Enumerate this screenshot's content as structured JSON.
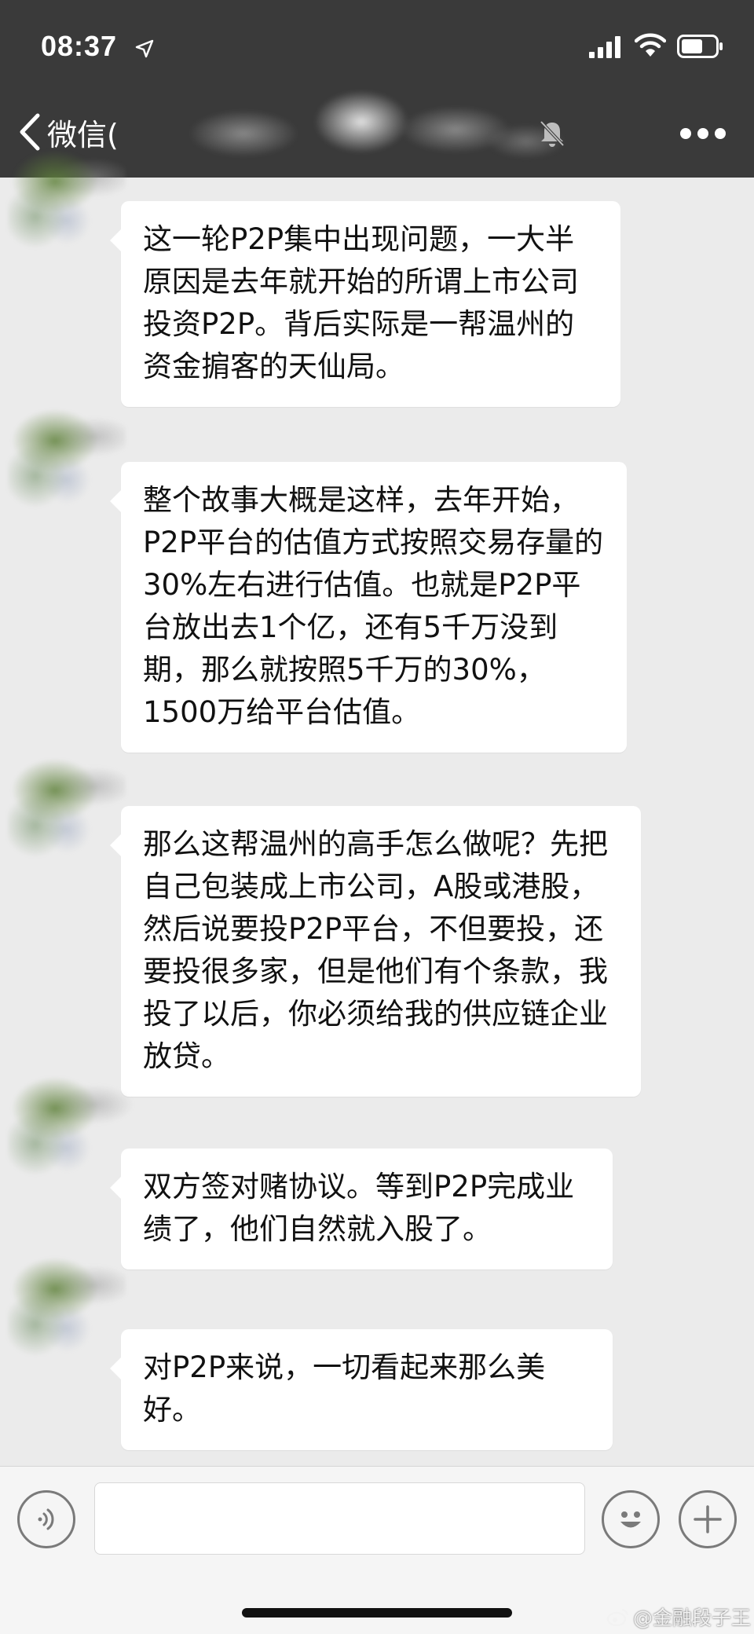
{
  "status_bar": {
    "time": "08:37"
  },
  "nav": {
    "back_label": "微信(",
    "chat_title": ""
  },
  "messages": [
    {
      "text": "这一轮P2P集中出现问题，一大半原因是去年就开始的所谓上市公司投资P2P。背后实际是一帮温州的资金掮客的天仙局。"
    },
    {
      "text": "整个故事大概是这样，去年开始，P2P平台的估值方式按照交易存量的30%左右进行估值。也就是P2P平台放出去1个亿，还有5千万没到期，那么就按照5千万的30%，1500万给平台估值。"
    },
    {
      "text": "那么这帮温州的高手怎么做呢？先把自己包装成上市公司，A股或港股，然后说要投P2P平台，不但要投，还要投很多家，但是他们有个条款，我投了以后，你必须给我的供应链企业放贷。"
    },
    {
      "text": "双方签对赌协议。等到P2P完成业绩了，他们自然就入股了。"
    },
    {
      "text": "对P2P来说，一切看起来那么美好。"
    }
  ],
  "watermark": {
    "text": "@金融段子王"
  },
  "icons": {
    "location": "location-arrow-icon",
    "signal": "cellular-signal-icon",
    "wifi": "wifi-icon",
    "battery": "battery-icon",
    "back": "chevron-left-icon",
    "mute": "mute-bell-icon",
    "more": "more-dots-icon",
    "voice": "voice-icon",
    "emoji": "emoji-icon",
    "plus": "plus-icon"
  },
  "colors": {
    "topbar_bg": "#3a3a3a",
    "chat_bg": "#ebebeb",
    "bubble_bg": "#ffffff"
  }
}
